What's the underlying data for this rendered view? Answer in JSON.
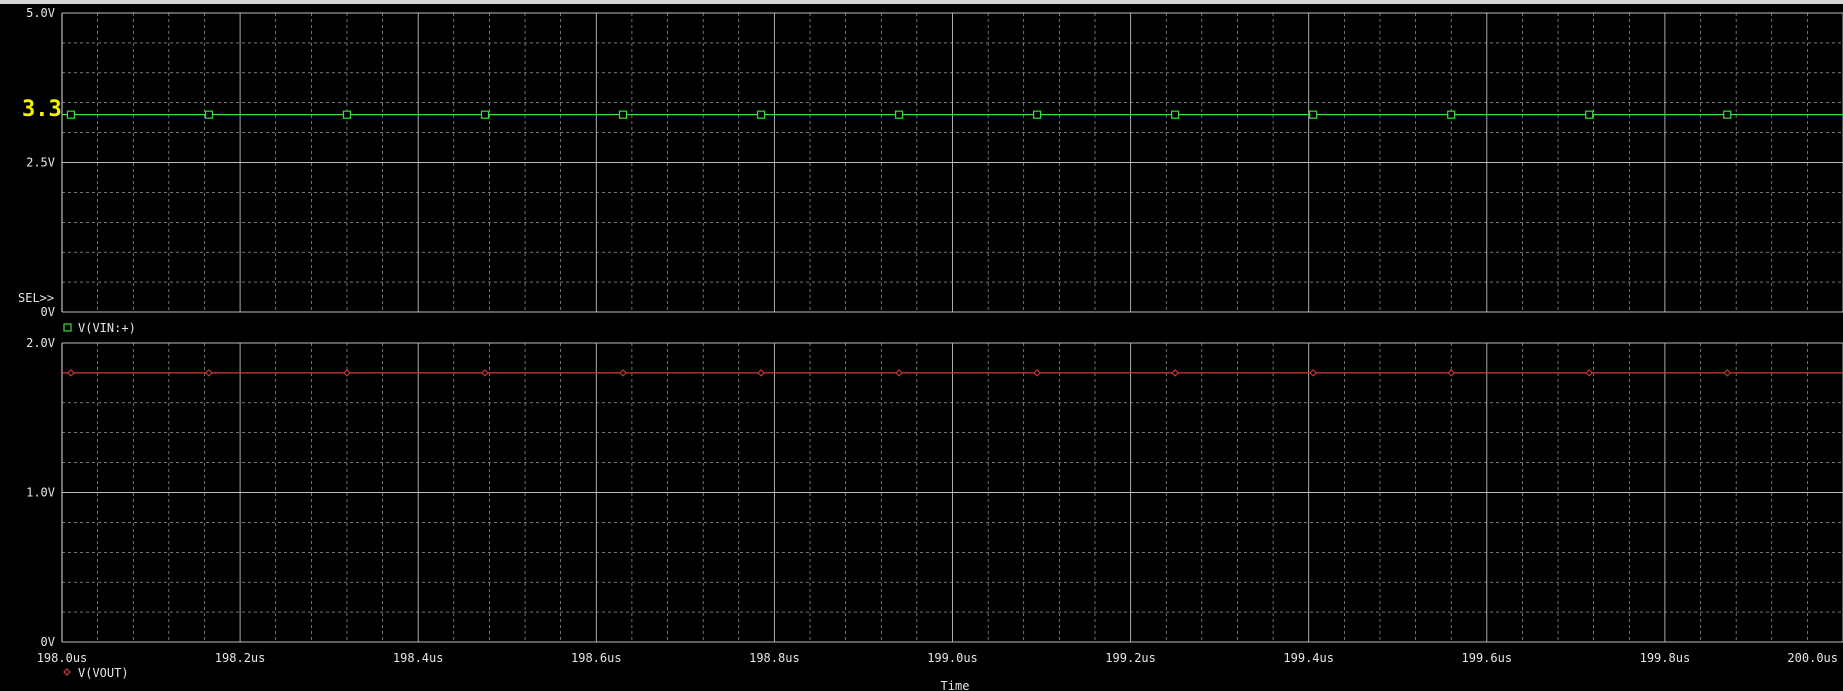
{
  "annotation": {
    "text": "3.3",
    "color": "#f5f500"
  },
  "sel_marker": "SEL>>",
  "x_axis": {
    "label": "Time",
    "min": 198.0,
    "max": 200.0,
    "ticks": [
      198.0,
      198.2,
      198.4,
      198.6,
      198.8,
      199.0,
      199.2,
      199.4,
      199.6,
      199.8,
      200.0
    ],
    "tick_labels": [
      "198.0us",
      "198.2us",
      "198.4us",
      "198.6us",
      "198.8us",
      "199.0us",
      "199.2us",
      "199.4us",
      "199.6us",
      "199.8us",
      "200.0us"
    ]
  },
  "colors": {
    "background": "#000000",
    "grid": "#bdbdbd",
    "text": "#e6e6e6",
    "vin": "#3cdc3c",
    "vout": "#d23c32"
  },
  "chart_data": [
    {
      "type": "line",
      "xlabel": "Time",
      "ylabel": "",
      "xlim": [
        198.0,
        200.0
      ],
      "ylim": [
        0,
        5.0
      ],
      "y_ticks": [
        0,
        2.5,
        5.0
      ],
      "y_tick_labels": [
        "0V",
        "2.5V",
        "5.0V"
      ],
      "grid": true,
      "legend": "bottom-left",
      "series": [
        {
          "name": "V(VIN:+)",
          "color": "#3cdc3c",
          "marker": "square",
          "x": [
            198.0,
            200.0
          ],
          "y": [
            3.3,
            3.3
          ],
          "marker_x": [
            198.01,
            198.165,
            198.32,
            198.475,
            198.63,
            198.785,
            198.94,
            199.095,
            199.25,
            199.405,
            199.56,
            199.715,
            199.87
          ]
        }
      ]
    },
    {
      "type": "line",
      "xlabel": "Time",
      "ylabel": "",
      "xlim": [
        198.0,
        200.0
      ],
      "ylim": [
        0,
        2.0
      ],
      "y_ticks": [
        0,
        1.0,
        2.0
      ],
      "y_tick_labels": [
        "0V",
        "1.0V",
        "2.0V"
      ],
      "grid": true,
      "legend": "bottom-left",
      "series": [
        {
          "name": "V(VOUT)",
          "color": "#d23c32",
          "marker": "diamond",
          "x": [
            198.0,
            200.0
          ],
          "y": [
            1.8,
            1.8
          ],
          "marker_x": [
            198.01,
            198.165,
            198.32,
            198.475,
            198.63,
            198.785,
            198.94,
            199.095,
            199.25,
            199.405,
            199.56,
            199.715,
            199.87
          ]
        }
      ]
    }
  ]
}
